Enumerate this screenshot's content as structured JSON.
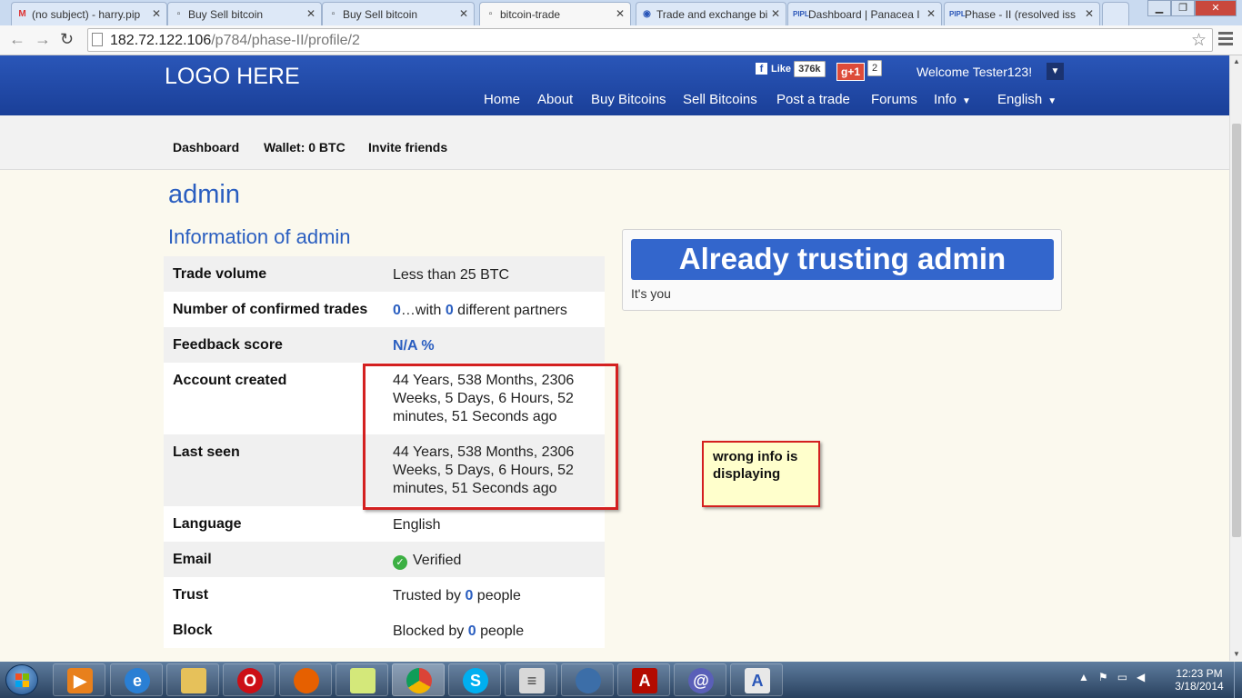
{
  "browser": {
    "tabs": [
      {
        "label": "(no subject) - harry.pip",
        "icon": "gmail-icon",
        "active": false
      },
      {
        "label": "Buy Sell bitcoin",
        "icon": "page-icon",
        "active": false
      },
      {
        "label": "Buy Sell bitcoin",
        "icon": "page-icon",
        "active": false
      },
      {
        "label": "bitcoin-trade",
        "icon": "page-icon",
        "active": true
      },
      {
        "label": "Trade and exchange bi",
        "icon": "bitcoin-icon",
        "active": false
      },
      {
        "label": "Dashboard | Panacea I",
        "icon": "pipl-icon",
        "active": false
      },
      {
        "label": "Phase - II (resolved iss",
        "icon": "pipl-icon",
        "active": false
      }
    ],
    "url_host": "182.72.122.106",
    "url_path": "/p784/phase-II/profile/2"
  },
  "header": {
    "logo": "LOGO HERE",
    "fb_like": "Like",
    "fb_count": "376k",
    "gplus_label": "g+1",
    "gplus_count": "2",
    "welcome": "Welcome Tester123!",
    "nav": [
      "Home",
      "About",
      "Buy Bitcoins",
      "Sell Bitcoins",
      "Post a trade",
      "Forums",
      "Info",
      "English"
    ]
  },
  "subnav": [
    "Dashboard",
    "Wallet: 0 BTC",
    "Invite friends"
  ],
  "profile": {
    "title": "admin",
    "section_title": "Information of admin",
    "rows": [
      {
        "label": "Trade volume",
        "value": "Less than 25 BTC"
      },
      {
        "label": "Number of confirmed trades",
        "value_parts": [
          "0",
          "…with ",
          "0",
          " different partners"
        ]
      },
      {
        "label": "Feedback score",
        "value": "N/A %"
      },
      {
        "label": "Account created",
        "value": "44 Years, 538 Months, 2306 Weeks, 5 Days, 6 Hours, 52 minutes, 51 Seconds ago"
      },
      {
        "label": "Last seen",
        "value": "44 Years, 538 Months, 2306 Weeks, 5 Days, 6 Hours, 52 minutes, 51 Seconds ago"
      },
      {
        "label": "Language",
        "value": "English"
      },
      {
        "label": "Email",
        "value": "Verified"
      },
      {
        "label": "Trust",
        "value_parts": [
          "Trusted by ",
          "0",
          " people"
        ]
      },
      {
        "label": "Block",
        "value_parts": [
          "Blocked by ",
          "0",
          " people"
        ]
      }
    ]
  },
  "trust_panel": {
    "button_label": "Already trusting admin",
    "note": "It's you"
  },
  "annotation": {
    "note": "wrong info is displaying"
  },
  "taskbar": {
    "apps": [
      "media-player-icon",
      "internet-explorer-icon",
      "file-explorer-icon",
      "opera-icon",
      "firefox-icon",
      "sticky-notes-icon",
      "chrome-icon",
      "skype-icon",
      "document-icon",
      "thunderbird-icon",
      "adobe-reader-icon",
      "app-icon",
      "text-editor-icon"
    ],
    "time": "12:23 PM",
    "date": "3/18/2014"
  }
}
